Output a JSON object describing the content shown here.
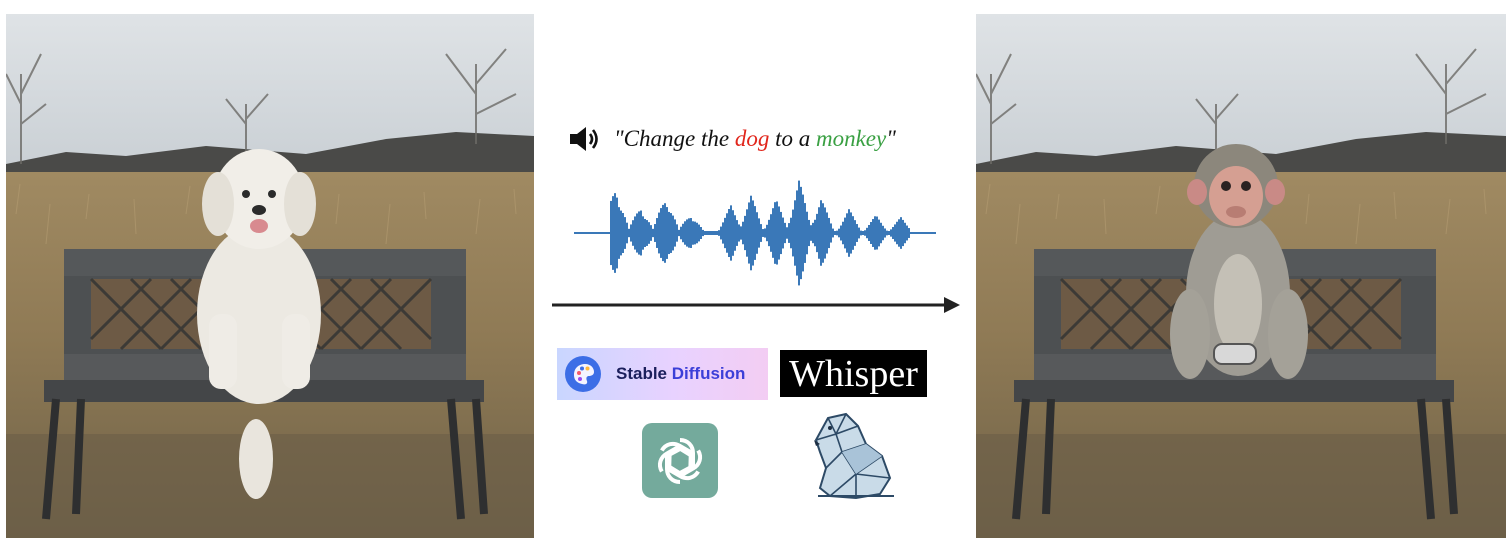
{
  "scene": {
    "left_photo": "dog-on-bench-photo",
    "right_photo": "monkey-on-bench-photo"
  },
  "prompt": {
    "icon": "speaker-icon",
    "open_quote": "\"Change the ",
    "dog_word": "dog",
    "middle": " to a ",
    "monkey_word": "monkey",
    "close_quote": "\"",
    "dog_color": "#e1261c",
    "monkey_color": "#3aa043"
  },
  "waveform": {
    "icon": "audio-waveform",
    "color": "#3a78b8"
  },
  "arrow": {
    "icon": "right-arrow-icon"
  },
  "logos": {
    "stable_diffusion": {
      "word1": "Stable",
      "word2": "Diffusion"
    },
    "whisper": {
      "text": "Whisper"
    },
    "openai": {
      "icon": "openai-icon",
      "color": "#74aa9c"
    },
    "bear": {
      "icon": "polar-bear-icon"
    }
  }
}
